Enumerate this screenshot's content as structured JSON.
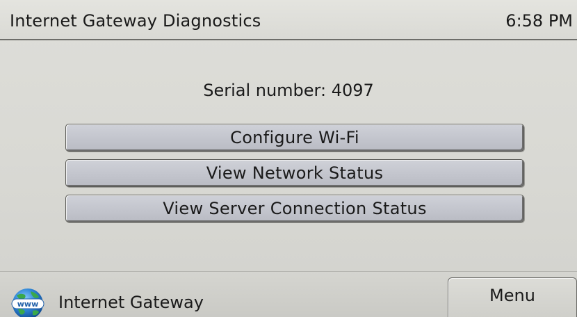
{
  "header": {
    "title": "Internet Gateway Diagnostics",
    "time": "6:58 PM"
  },
  "main": {
    "serial_label": "Serial number:",
    "serial_value": "4097",
    "buttons": [
      {
        "label": "Configure Wi-Fi"
      },
      {
        "label": "View Network Status"
      },
      {
        "label": "View Server Connection Status"
      }
    ]
  },
  "footer": {
    "icon": "globe-www-icon",
    "icon_text": "www",
    "label": "Internet Gateway",
    "menu_label": "Menu"
  },
  "colors": {
    "background": "#d9d9d4",
    "button": "#c3c5cd",
    "text": "#1a1a1a"
  }
}
